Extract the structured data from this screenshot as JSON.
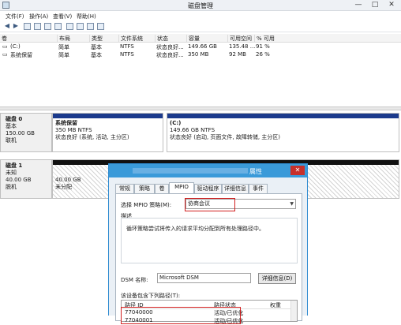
{
  "window": {
    "title": "磁盘管理",
    "controls": [
      "—",
      "□",
      "✕"
    ]
  },
  "menu": [
    "文件(F)",
    "操作(A)",
    "查看(V)",
    "帮助(H)"
  ],
  "volume_table": {
    "columns": [
      "卷",
      "布局",
      "类型",
      "文件系统",
      "状态",
      "容量",
      "可用空间",
      "% 可用"
    ],
    "rows": [
      [
        "(C:)",
        "简单",
        "基本",
        "NTFS",
        "状态良好...",
        "149.66 GB",
        "135.48 ...",
        "91 %"
      ],
      [
        "系统保留",
        "简单",
        "基本",
        "NTFS",
        "状态良好...",
        "350 MB",
        "92 MB",
        "26 %"
      ]
    ]
  },
  "disks": [
    {
      "name": "磁盘 0",
      "type": "基本",
      "size": "150.00 GB",
      "status": "联机",
      "partitions": [
        {
          "name": "系统保留",
          "line1": "350 MB NTFS",
          "line2": "状态良好 (系统, 活动, 主分区)"
        },
        {
          "name": "(C:)",
          "line1": "149.66 GB NTFS",
          "line2": "状态良好 (启动, 页面文件, 故障转储, 主分区)"
        }
      ]
    },
    {
      "name": "磁盘 1",
      "type": "未知",
      "size": "40.00 GB",
      "status": "脱机",
      "partitions": [
        {
          "name": "",
          "line1": "40.00 GB",
          "line2": "未分配"
        }
      ]
    }
  ],
  "dialog": {
    "title_suffix": "属性",
    "tabs": [
      "常规",
      "策略",
      "卷",
      "MPIO",
      "驱动程序",
      "详细信息",
      "事件"
    ],
    "active_tab": "MPIO",
    "policy_label": "选择 MPIO 策略(M):",
    "policy_value": "协商会议",
    "description_title": "描述",
    "description_text": "循环策略尝试将传入的请求平均分配到所有处理路径中。",
    "dsm_label": "DSM 名称:",
    "dsm_value": "Microsoft DSM",
    "details_button": "详细信息(D)",
    "paths_label": "该设备包含下列路径(T):",
    "paths_columns": [
      "路径 ID",
      "路径状态",
      "权重"
    ],
    "paths": [
      {
        "id": "77040000",
        "state": "活动/已优化",
        "weight": ""
      },
      {
        "id": "77040001",
        "state": "活动/已优化",
        "weight": ""
      }
    ]
  },
  "colors": {
    "accent": "#3a9ad9",
    "partition_bar": "#1b3a8c",
    "highlight": "#d21f1f"
  }
}
